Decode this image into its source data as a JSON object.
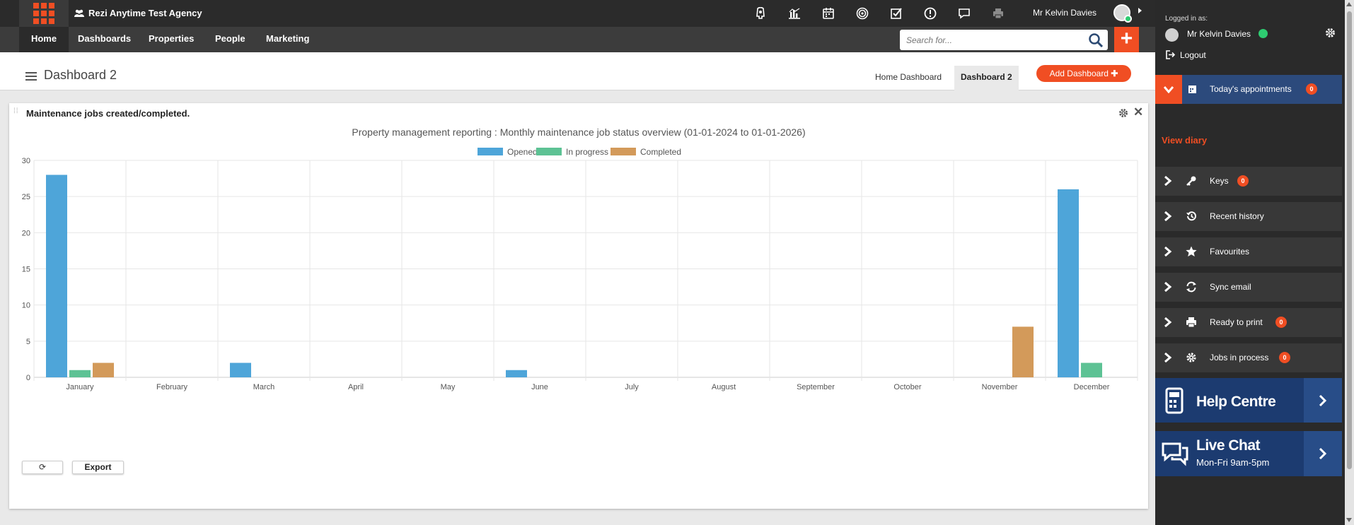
{
  "topbar": {
    "agency_name": "Rezi Anytime Test Agency",
    "user_name": "Mr Kelvin Davies",
    "icons": [
      "spaceship-icon",
      "bar-chart-icon",
      "calendar-icon",
      "target-icon",
      "checkbox-icon",
      "alert-icon",
      "comment-icon",
      "printer-icon"
    ]
  },
  "nav": {
    "home": "Home",
    "dashboards": "Dashboards",
    "properties": "Properties",
    "people": "People",
    "marketing": "Marketing"
  },
  "search": {
    "placeholder": "Search for..."
  },
  "dashboard": {
    "title": "Dashboard 2",
    "tabs": [
      "Home Dashboard",
      "Dashboard 2"
    ],
    "active_tab": "Dashboard 2",
    "add_label": "Add Dashboard"
  },
  "widget": {
    "title": "Maintenance jobs created/completed.",
    "export_label": "Export"
  },
  "chart_data": {
    "type": "bar",
    "title": "Property management reporting : Monthly maintenance job status overview  (01-01-2024 to 01-01-2026)",
    "categories": [
      "January",
      "February",
      "March",
      "April",
      "May",
      "June",
      "July",
      "August",
      "September",
      "October",
      "November",
      "December"
    ],
    "series": [
      {
        "name": "Opened",
        "color": "#4ea5d9",
        "values": [
          28,
          0,
          2,
          0,
          0,
          1,
          0,
          0,
          0,
          0,
          0,
          26
        ]
      },
      {
        "name": "In progress",
        "color": "#5dc294",
        "values": [
          1,
          0,
          0,
          0,
          0,
          0,
          0,
          0,
          0,
          0,
          0,
          2
        ]
      },
      {
        "name": "Completed",
        "color": "#d39a5a",
        "values": [
          2,
          0,
          0,
          0,
          0,
          0,
          0,
          0,
          0,
          0,
          7,
          0
        ]
      }
    ],
    "ylim": [
      0,
      30
    ],
    "yticks": [
      0,
      5,
      10,
      15,
      20,
      25,
      30
    ],
    "legend": "top-center",
    "grid": true
  },
  "panel": {
    "logged_in_label": "Logged in as:",
    "user_name": "Mr Kelvin Davies",
    "logout": "Logout",
    "appointments": {
      "label": "Today's appointments",
      "count": "0"
    },
    "view_diary": "View diary",
    "items": [
      {
        "label": "Keys",
        "icon": "key-icon",
        "count": "0"
      },
      {
        "label": "Recent history",
        "icon": "history-icon",
        "count": null
      },
      {
        "label": "Favourites",
        "icon": "star-icon",
        "count": null
      },
      {
        "label": "Sync email",
        "icon": "sync-icon",
        "count": null
      },
      {
        "label": "Ready to print",
        "icon": "printer-icon",
        "count": "0"
      },
      {
        "label": "Jobs in process",
        "icon": "gear-icon",
        "count": "0"
      }
    ],
    "help": {
      "label": "Help Centre"
    },
    "chat": {
      "label": "Live Chat",
      "hours": "Mon-Fri 9am-5pm"
    }
  }
}
